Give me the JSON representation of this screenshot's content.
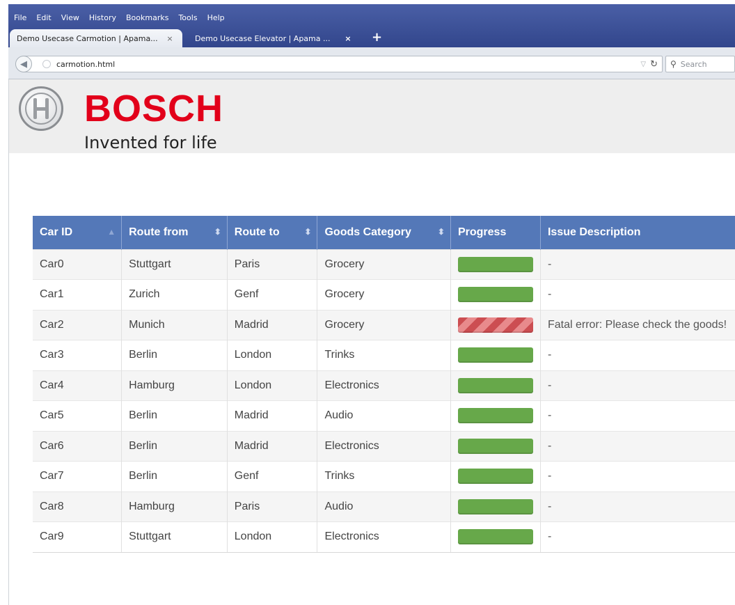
{
  "browser": {
    "menu": [
      "File",
      "Edit",
      "View",
      "History",
      "Bookmarks",
      "Tools",
      "Help"
    ],
    "tabs": [
      {
        "title": "Demo Usecase Carmotion | Apama...",
        "close": "×"
      },
      {
        "title": "Demo Usecase Elevator | Apama ...",
        "close": "×"
      }
    ],
    "new_tab": "+",
    "url": "carmotion.html",
    "search_placeholder": "Search"
  },
  "brand": {
    "wordmark": "BOSCH",
    "tagline": "Invented for life",
    "color": "#e2001a"
  },
  "table": {
    "headers": [
      "Car ID",
      "Route from",
      "Route to",
      "Goods Category",
      "Progress",
      "Issue Description"
    ],
    "rows": [
      {
        "car_id": "Car0",
        "from": "Stuttgart",
        "to": "Paris",
        "category": "Grocery",
        "status": "ok",
        "issue": "-"
      },
      {
        "car_id": "Car1",
        "from": "Zurich",
        "to": "Genf",
        "category": "Grocery",
        "status": "ok",
        "issue": "-"
      },
      {
        "car_id": "Car2",
        "from": "Munich",
        "to": "Madrid",
        "category": "Grocery",
        "status": "error",
        "issue": "Fatal error: Please check the goods!"
      },
      {
        "car_id": "Car3",
        "from": "Berlin",
        "to": "London",
        "category": "Trinks",
        "status": "ok",
        "issue": "-"
      },
      {
        "car_id": "Car4",
        "from": "Hamburg",
        "to": "London",
        "category": "Electronics",
        "status": "ok",
        "issue": "-"
      },
      {
        "car_id": "Car5",
        "from": "Berlin",
        "to": "Madrid",
        "category": "Audio",
        "status": "ok",
        "issue": "-"
      },
      {
        "car_id": "Car6",
        "from": "Berlin",
        "to": "Madrid",
        "category": "Electronics",
        "status": "ok",
        "issue": "-"
      },
      {
        "car_id": "Car7",
        "from": "Berlin",
        "to": "Genf",
        "category": "Trinks",
        "status": "ok",
        "issue": "-"
      },
      {
        "car_id": "Car8",
        "from": "Hamburg",
        "to": "Paris",
        "category": "Audio",
        "status": "ok",
        "issue": "-"
      },
      {
        "car_id": "Car9",
        "from": "Stuttgart",
        "to": "London",
        "category": "Electronics",
        "status": "ok",
        "issue": "-"
      }
    ],
    "colors": {
      "header": "#5478b8",
      "ok": "#67a84a",
      "error": "#cc4e52"
    }
  }
}
